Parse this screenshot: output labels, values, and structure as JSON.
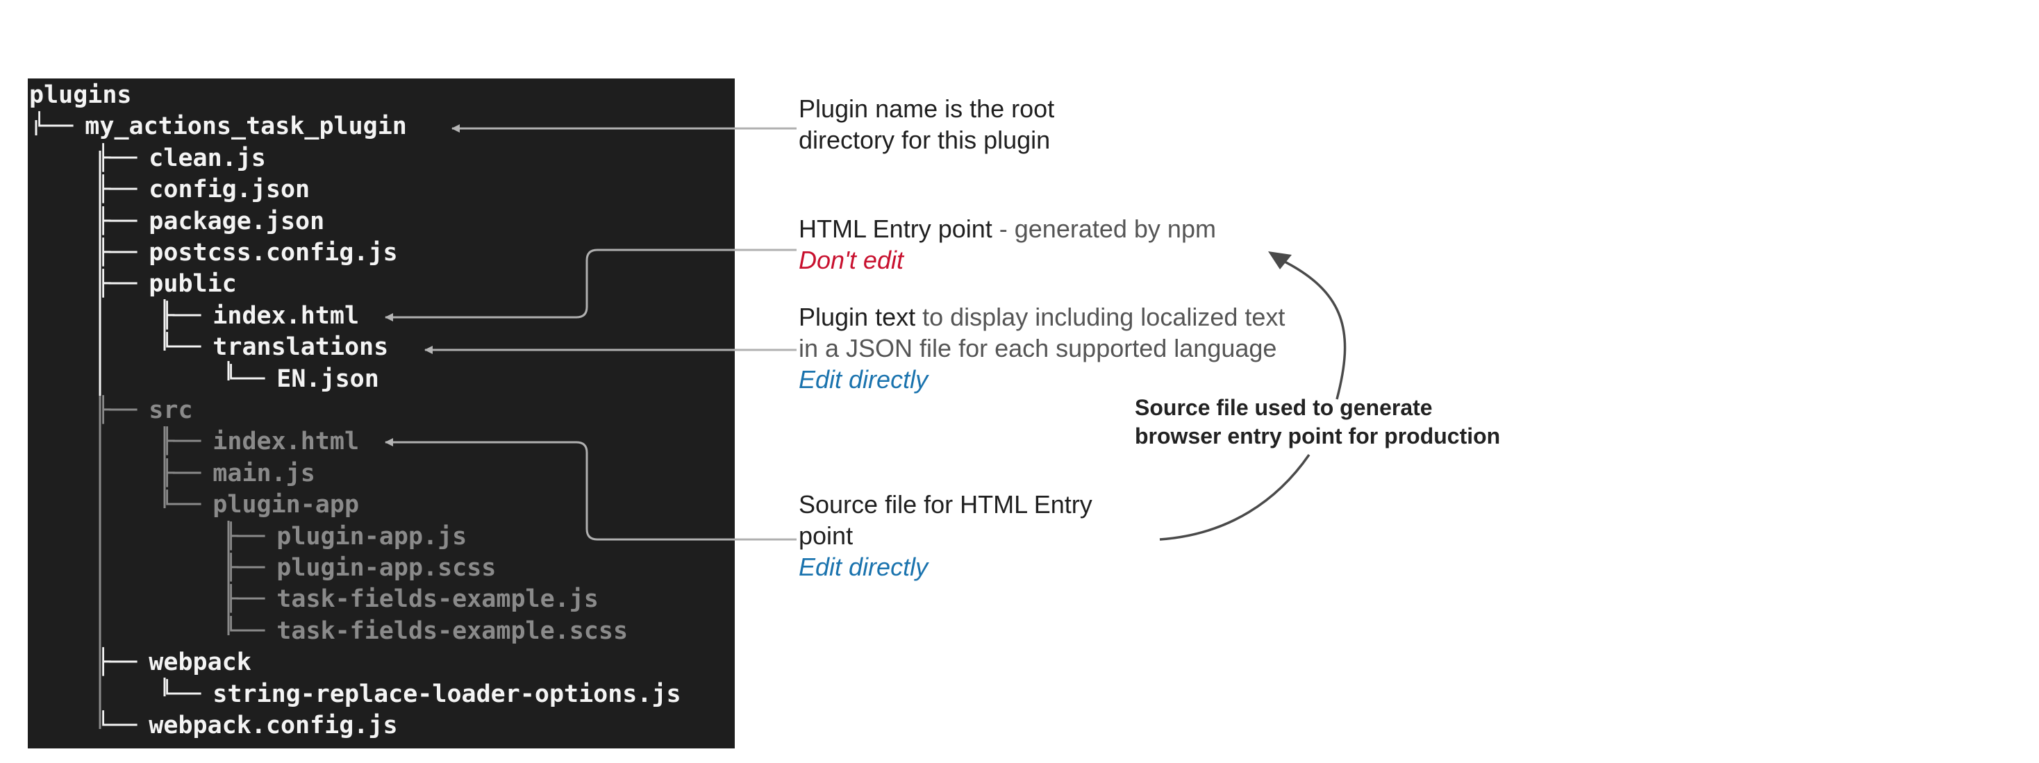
{
  "tree": [
    {
      "glyph": "",
      "name": "plugins",
      "dim": false,
      "indent": 0
    },
    {
      "glyph": "└── ",
      "name": "my_actions_task_plugin",
      "dim": false,
      "indent": 0
    },
    {
      "glyph": "├── ",
      "name": "clean.js",
      "dim": false,
      "indent": 1
    },
    {
      "glyph": "├── ",
      "name": "config.json",
      "dim": false,
      "indent": 1
    },
    {
      "glyph": "├── ",
      "name": "package.json",
      "dim": false,
      "indent": 1
    },
    {
      "glyph": "├── ",
      "name": "postcss.config.js",
      "dim": false,
      "indent": 1
    },
    {
      "glyph": "├── ",
      "name": "public",
      "dim": false,
      "indent": 1
    },
    {
      "glyph": "├── ",
      "name": "index.html",
      "dim": false,
      "indent": 2
    },
    {
      "glyph": "└── ",
      "name": "translations",
      "dim": false,
      "indent": 2
    },
    {
      "glyph": "└── ",
      "name": "EN.json",
      "dim": false,
      "indent": 3
    },
    {
      "glyph": "├── ",
      "name": "src",
      "dim": true,
      "indent": 1
    },
    {
      "glyph": "├── ",
      "name": "index.html",
      "dim": true,
      "indent": 2
    },
    {
      "glyph": "├── ",
      "name": "main.js",
      "dim": true,
      "indent": 2
    },
    {
      "glyph": "└── ",
      "name": "plugin-app",
      "dim": true,
      "indent": 2
    },
    {
      "glyph": "├── ",
      "name": "plugin-app.js",
      "dim": true,
      "indent": 3
    },
    {
      "glyph": "├── ",
      "name": "plugin-app.scss",
      "dim": true,
      "indent": 3
    },
    {
      "glyph": "├── ",
      "name": "task-fields-example.js",
      "dim": true,
      "indent": 3
    },
    {
      "glyph": "└── ",
      "name": "task-fields-example.scss",
      "dim": true,
      "indent": 3
    },
    {
      "glyph": "├── ",
      "name": "webpack",
      "dim": false,
      "indent": 1
    },
    {
      "glyph": "└── ",
      "name": "string-replace-loader-options.js",
      "dim": false,
      "indent": 2
    },
    {
      "glyph": "└── ",
      "name": "webpack.config.js",
      "dim": false,
      "indent": 1
    }
  ],
  "annotations": {
    "plugin_name": {
      "line1": "Plugin name is the root",
      "line2": "directory for this plugin"
    },
    "html_entry": {
      "title": "HTML Entry point",
      "suffix": " - generated by npm",
      "status": "Don't edit"
    },
    "plugin_text": {
      "title": "Plugin text",
      "line1_rest": " to display including localized text",
      "line2": "in a JSON file for each supported language",
      "status": "Edit directly"
    },
    "source_file": {
      "line1": "Source file for HTML Entry",
      "line2": "point",
      "status": "Edit directly"
    },
    "generator": {
      "line1": "Source file used to generate",
      "line2": "browser entry point for production"
    }
  },
  "colors": {
    "terminal_bg": "#1e1e1e",
    "bright_text": "#f4f4f4",
    "dim_text": "#8a8a8a",
    "arrow": "#9a9a9a",
    "curved_arrow": "#4a4a4a",
    "dont_edit": "#c8102e",
    "edit_directly": "#1a73ae"
  }
}
